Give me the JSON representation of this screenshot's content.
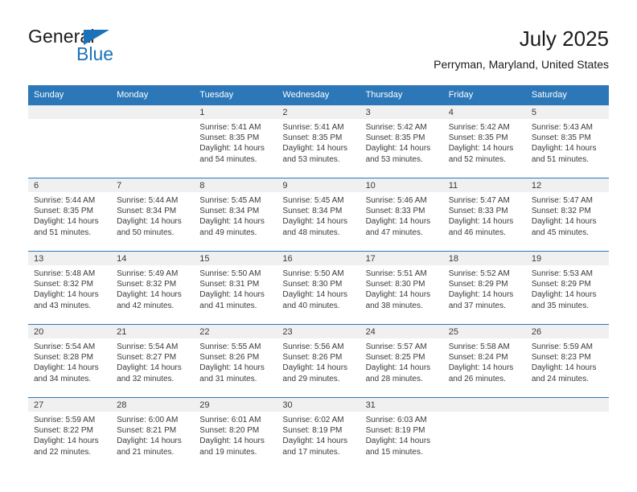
{
  "brand": {
    "name_top": "General",
    "name_bottom": "Blue",
    "triangle_color": "#1c72b8",
    "text_color": "#1b1b1b"
  },
  "header": {
    "title": "July 2025",
    "subtitle": "Perryman, Maryland, United States"
  },
  "theme": {
    "header_blue": "#2b77b8",
    "day_band_gray": "#f0f0f0",
    "text_color": "#3a3a3a"
  },
  "weekday_headers": [
    "Sunday",
    "Monday",
    "Tuesday",
    "Wednesday",
    "Thursday",
    "Friday",
    "Saturday"
  ],
  "weeks": [
    [
      {
        "day": "",
        "sunrise": "",
        "sunset": "",
        "daylight": ""
      },
      {
        "day": "",
        "sunrise": "",
        "sunset": "",
        "daylight": ""
      },
      {
        "day": "1",
        "sunrise": "Sunrise: 5:41 AM",
        "sunset": "Sunset: 8:35 PM",
        "daylight": "Daylight: 14 hours and 54 minutes."
      },
      {
        "day": "2",
        "sunrise": "Sunrise: 5:41 AM",
        "sunset": "Sunset: 8:35 PM",
        "daylight": "Daylight: 14 hours and 53 minutes."
      },
      {
        "day": "3",
        "sunrise": "Sunrise: 5:42 AM",
        "sunset": "Sunset: 8:35 PM",
        "daylight": "Daylight: 14 hours and 53 minutes."
      },
      {
        "day": "4",
        "sunrise": "Sunrise: 5:42 AM",
        "sunset": "Sunset: 8:35 PM",
        "daylight": "Daylight: 14 hours and 52 minutes."
      },
      {
        "day": "5",
        "sunrise": "Sunrise: 5:43 AM",
        "sunset": "Sunset: 8:35 PM",
        "daylight": "Daylight: 14 hours and 51 minutes."
      }
    ],
    [
      {
        "day": "6",
        "sunrise": "Sunrise: 5:44 AM",
        "sunset": "Sunset: 8:35 PM",
        "daylight": "Daylight: 14 hours and 51 minutes."
      },
      {
        "day": "7",
        "sunrise": "Sunrise: 5:44 AM",
        "sunset": "Sunset: 8:34 PM",
        "daylight": "Daylight: 14 hours and 50 minutes."
      },
      {
        "day": "8",
        "sunrise": "Sunrise: 5:45 AM",
        "sunset": "Sunset: 8:34 PM",
        "daylight": "Daylight: 14 hours and 49 minutes."
      },
      {
        "day": "9",
        "sunrise": "Sunrise: 5:45 AM",
        "sunset": "Sunset: 8:34 PM",
        "daylight": "Daylight: 14 hours and 48 minutes."
      },
      {
        "day": "10",
        "sunrise": "Sunrise: 5:46 AM",
        "sunset": "Sunset: 8:33 PM",
        "daylight": "Daylight: 14 hours and 47 minutes."
      },
      {
        "day": "11",
        "sunrise": "Sunrise: 5:47 AM",
        "sunset": "Sunset: 8:33 PM",
        "daylight": "Daylight: 14 hours and 46 minutes."
      },
      {
        "day": "12",
        "sunrise": "Sunrise: 5:47 AM",
        "sunset": "Sunset: 8:32 PM",
        "daylight": "Daylight: 14 hours and 45 minutes."
      }
    ],
    [
      {
        "day": "13",
        "sunrise": "Sunrise: 5:48 AM",
        "sunset": "Sunset: 8:32 PM",
        "daylight": "Daylight: 14 hours and 43 minutes."
      },
      {
        "day": "14",
        "sunrise": "Sunrise: 5:49 AM",
        "sunset": "Sunset: 8:32 PM",
        "daylight": "Daylight: 14 hours and 42 minutes."
      },
      {
        "day": "15",
        "sunrise": "Sunrise: 5:50 AM",
        "sunset": "Sunset: 8:31 PM",
        "daylight": "Daylight: 14 hours and 41 minutes."
      },
      {
        "day": "16",
        "sunrise": "Sunrise: 5:50 AM",
        "sunset": "Sunset: 8:30 PM",
        "daylight": "Daylight: 14 hours and 40 minutes."
      },
      {
        "day": "17",
        "sunrise": "Sunrise: 5:51 AM",
        "sunset": "Sunset: 8:30 PM",
        "daylight": "Daylight: 14 hours and 38 minutes."
      },
      {
        "day": "18",
        "sunrise": "Sunrise: 5:52 AM",
        "sunset": "Sunset: 8:29 PM",
        "daylight": "Daylight: 14 hours and 37 minutes."
      },
      {
        "day": "19",
        "sunrise": "Sunrise: 5:53 AM",
        "sunset": "Sunset: 8:29 PM",
        "daylight": "Daylight: 14 hours and 35 minutes."
      }
    ],
    [
      {
        "day": "20",
        "sunrise": "Sunrise: 5:54 AM",
        "sunset": "Sunset: 8:28 PM",
        "daylight": "Daylight: 14 hours and 34 minutes."
      },
      {
        "day": "21",
        "sunrise": "Sunrise: 5:54 AM",
        "sunset": "Sunset: 8:27 PM",
        "daylight": "Daylight: 14 hours and 32 minutes."
      },
      {
        "day": "22",
        "sunrise": "Sunrise: 5:55 AM",
        "sunset": "Sunset: 8:26 PM",
        "daylight": "Daylight: 14 hours and 31 minutes."
      },
      {
        "day": "23",
        "sunrise": "Sunrise: 5:56 AM",
        "sunset": "Sunset: 8:26 PM",
        "daylight": "Daylight: 14 hours and 29 minutes."
      },
      {
        "day": "24",
        "sunrise": "Sunrise: 5:57 AM",
        "sunset": "Sunset: 8:25 PM",
        "daylight": "Daylight: 14 hours and 28 minutes."
      },
      {
        "day": "25",
        "sunrise": "Sunrise: 5:58 AM",
        "sunset": "Sunset: 8:24 PM",
        "daylight": "Daylight: 14 hours and 26 minutes."
      },
      {
        "day": "26",
        "sunrise": "Sunrise: 5:59 AM",
        "sunset": "Sunset: 8:23 PM",
        "daylight": "Daylight: 14 hours and 24 minutes."
      }
    ],
    [
      {
        "day": "27",
        "sunrise": "Sunrise: 5:59 AM",
        "sunset": "Sunset: 8:22 PM",
        "daylight": "Daylight: 14 hours and 22 minutes."
      },
      {
        "day": "28",
        "sunrise": "Sunrise: 6:00 AM",
        "sunset": "Sunset: 8:21 PM",
        "daylight": "Daylight: 14 hours and 21 minutes."
      },
      {
        "day": "29",
        "sunrise": "Sunrise: 6:01 AM",
        "sunset": "Sunset: 8:20 PM",
        "daylight": "Daylight: 14 hours and 19 minutes."
      },
      {
        "day": "30",
        "sunrise": "Sunrise: 6:02 AM",
        "sunset": "Sunset: 8:19 PM",
        "daylight": "Daylight: 14 hours and 17 minutes."
      },
      {
        "day": "31",
        "sunrise": "Sunrise: 6:03 AM",
        "sunset": "Sunset: 8:19 PM",
        "daylight": "Daylight: 14 hours and 15 minutes."
      },
      {
        "day": "",
        "sunrise": "",
        "sunset": "",
        "daylight": ""
      },
      {
        "day": "",
        "sunrise": "",
        "sunset": "",
        "daylight": ""
      }
    ]
  ]
}
